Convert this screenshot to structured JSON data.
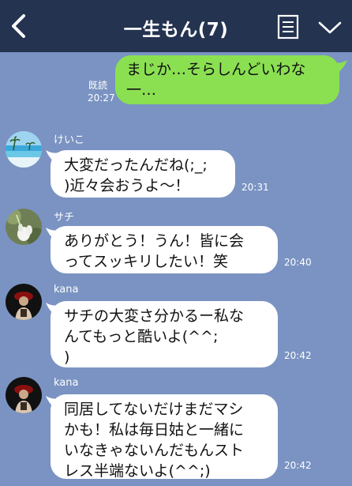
{
  "header": {
    "title": "一生もん(7)",
    "background": "#243350"
  },
  "chat_background": "#7a93c2",
  "messages": [
    {
      "direction": "out",
      "text": "まじか…そらしんどいわな\n一…",
      "read_label": "既読",
      "time": "20:27",
      "bubble_color": "#8be052"
    },
    {
      "direction": "in",
      "sender": "けいこ",
      "avatar_icon": "beach-photo-icon",
      "text": "大変だったんだね(;_;\n)近々会おうよ〜！",
      "time": "20:31"
    },
    {
      "direction": "in",
      "sender": "サチ",
      "avatar_icon": "flower-photo-icon",
      "text": "ありがとう！うん！皆に会\nってスッキリしたい！笑",
      "time": "20:40"
    },
    {
      "direction": "in",
      "sender": "kana",
      "avatar_icon": "person-photo-icon",
      "text": "サチの大変さ分かるー私な\nんてもっと酷いよ(^^;\n)",
      "time": "20:42"
    },
    {
      "direction": "in",
      "sender": "kana",
      "avatar_icon": "person-photo-icon",
      "text": "同居してないだけまだマシ\nかも！私は毎日姑と一緒に\nいなきゃないんだもんスト\nレス半端ないよ(^^;)",
      "time": "20:42"
    }
  ]
}
